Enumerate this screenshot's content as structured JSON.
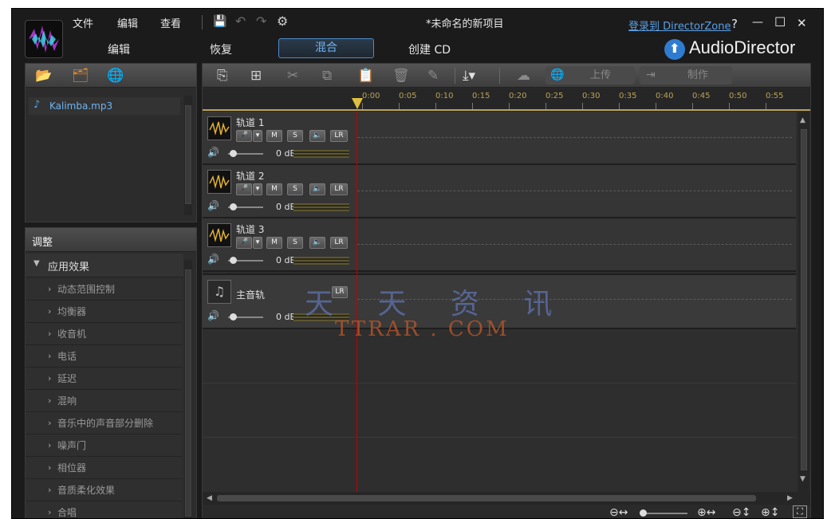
{
  "menu": {
    "file": "文件",
    "edit": "编辑",
    "view": "查看"
  },
  "title": "*未命名的新项目",
  "login_link": "登录到 DirectorZone",
  "window_controls": {
    "help": "?",
    "minimize": "—",
    "maximize": "☐",
    "close": "✕"
  },
  "brand": "AudioDirector",
  "modes": {
    "edit": "编辑",
    "restore": "恢复",
    "mix": "混合",
    "burn": "创建 CD"
  },
  "library": {
    "files": [
      "Kalimba.mp3"
    ]
  },
  "adjust": {
    "title": "调整",
    "group": "应用效果",
    "effects": [
      "动态范围控制",
      "均衡器",
      "收音机",
      "电话",
      "延迟",
      "混响",
      "音乐中的声音部分删除",
      "噪声门",
      "相位器",
      "音质柔化效果",
      "合唱"
    ]
  },
  "toolbar": {
    "upload": "上传",
    "produce": "制作"
  },
  "timeline": {
    "ticks": [
      "0:00",
      "0:05",
      "0:10",
      "0:15",
      "0:20",
      "0:25",
      "0:30",
      "0:35",
      "0:40",
      "0:45",
      "0:50",
      "0:55"
    ]
  },
  "tracks": [
    {
      "name": "轨道 1",
      "mute": "M",
      "solo": "S",
      "db": "0 dB",
      "lr": "LR"
    },
    {
      "name": "轨道 2",
      "mute": "M",
      "solo": "S",
      "db": "0 dB",
      "lr": "LR"
    },
    {
      "name": "轨道 3",
      "mute": "M",
      "solo": "S",
      "db": "0 dB",
      "lr": "LR"
    }
  ],
  "master": {
    "name": "主音轨",
    "db": "0 dB",
    "lr": "LR"
  },
  "watermark": {
    "cn": "天 天 资 讯",
    "en": "TTRAR . COM"
  },
  "colors": {
    "accent": "#4e8bc6",
    "playhead": "#c00000",
    "link": "#5aa0e6"
  }
}
